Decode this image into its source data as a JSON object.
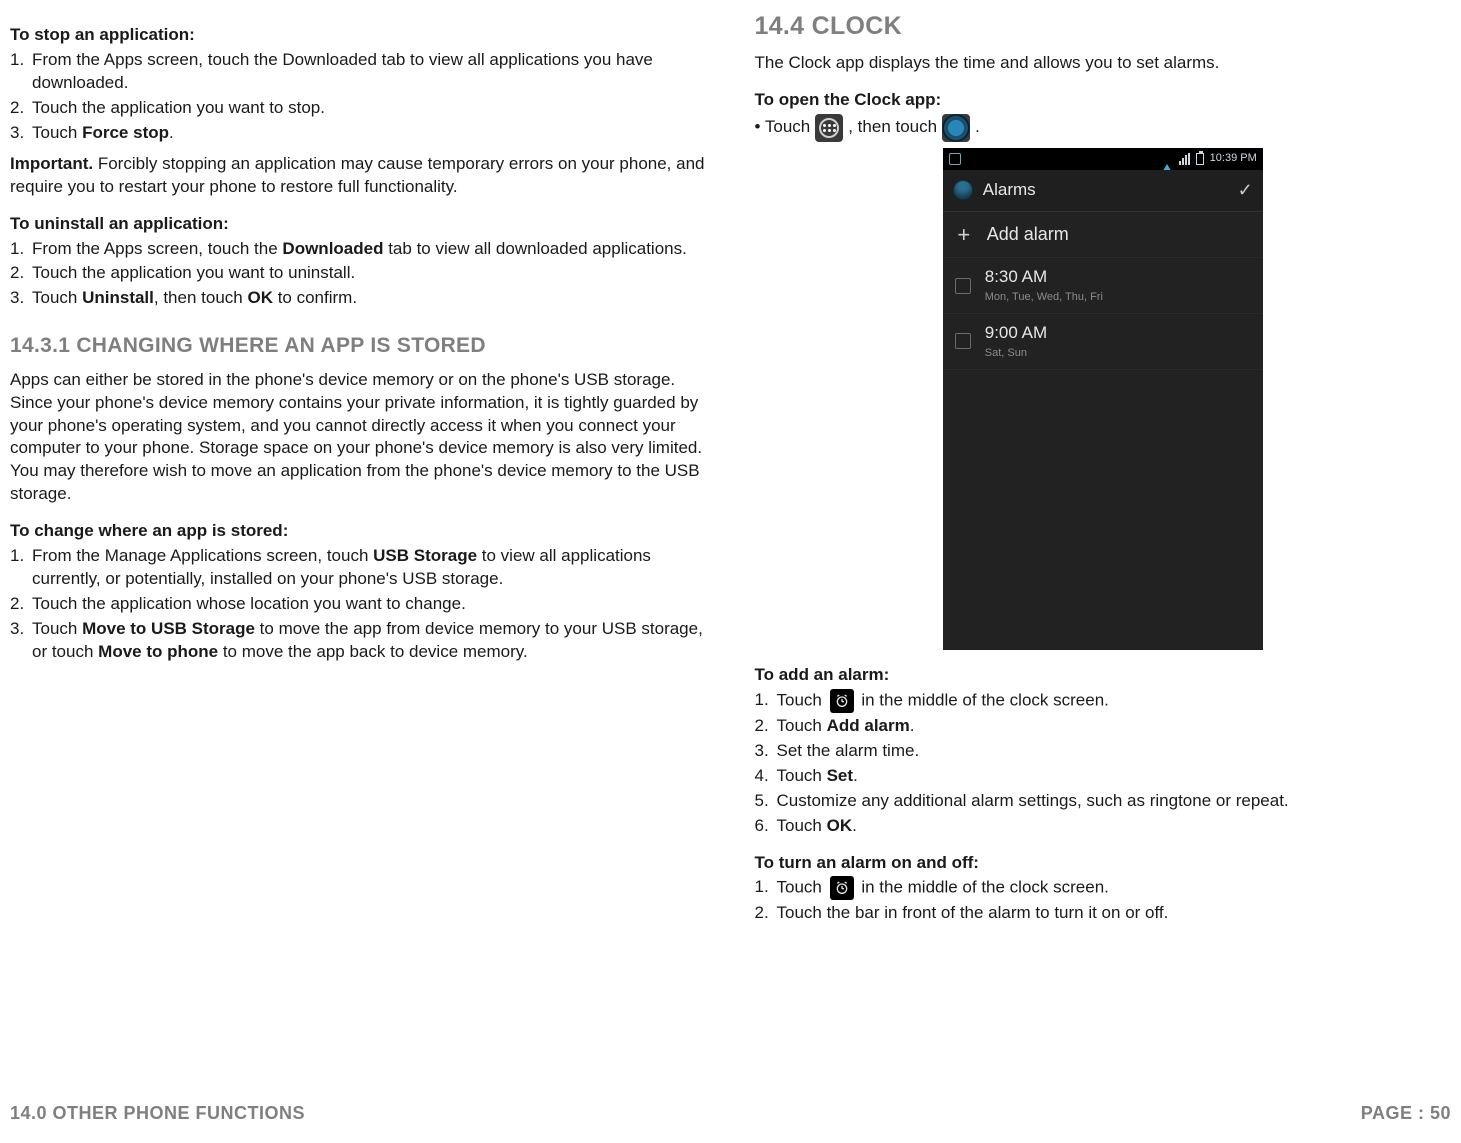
{
  "left": {
    "stop_app_heading": "To stop an application:",
    "stop_app_steps": [
      {
        "text": "From the Apps screen, touch the Downloaded tab to view all applications you have downloaded."
      },
      {
        "text": "Touch the application you want to stop."
      },
      {
        "prefix": "Touch ",
        "bold": "Force stop",
        "suffix": "."
      }
    ],
    "important_label": "Important.",
    "important_text": " Forcibly stopping an application may cause temporary errors on your phone, and require you to restart your phone to restore full functionality.",
    "uninstall_heading": "To uninstall an application:",
    "uninstall_steps": [
      {
        "prefix": "From the Apps screen, touch the ",
        "bold": "Downloaded",
        "suffix": " tab to view all downloaded applications."
      },
      {
        "text": "Touch the application you want to uninstall."
      },
      {
        "prefix": "Touch ",
        "bold": "Uninstall",
        "mid": ", then touch ",
        "bold2": "OK",
        "suffix": " to confirm."
      }
    ],
    "section_1431": "14.3.1 CHANGING WHERE AN APP IS STORED",
    "storage_para": "Apps can either be stored in the phone's device memory or on the phone's USB storage. Since your phone's device memory contains your private information, it is tightly guarded by your phone's operating system, and you cannot directly access it when you connect your computer to your phone. Storage space on your phone's device memory is also very limited. You may therefore wish to move an application from the phone's device memory to the USB storage.",
    "change_heading": "To change where an app is stored:",
    "change_steps": [
      {
        "prefix": "From the Manage Applications screen, touch ",
        "bold": "USB Storage",
        "suffix": " to view all applications currently, or potentially, installed on your phone's USB storage."
      },
      {
        "text": "Touch the application whose location you want to change."
      },
      {
        "prefix": "Touch ",
        "bold": "Move to USB Storage",
        "mid": " to move the app from device memory to your USB storage,",
        "line2_prefix": "or touch ",
        "line2_bold": "Move to phone",
        "line2_suffix": " to move the app back to device memory."
      }
    ]
  },
  "right": {
    "section_144": "14.4 CLOCK",
    "clock_intro": "The Clock app displays the time and allows you to set alarms.",
    "open_heading": "To open the Clock app:",
    "open_line_prefix": "• Touch ",
    "open_line_mid": ", then touch ",
    "open_line_suffix": ".",
    "add_heading": "To add an alarm:",
    "add_steps": [
      {
        "prefix": "Touch ",
        "icon": "alarm-icon",
        "suffix": " in the middle of the clock screen."
      },
      {
        "prefix": "Touch ",
        "bold": "Add alarm",
        "suffix": "."
      },
      {
        "text": "Set the alarm time."
      },
      {
        "prefix": "Touch ",
        "bold": "Set",
        "suffix": "."
      },
      {
        "text": "Customize any additional alarm settings, such as ringtone or repeat."
      },
      {
        "prefix": "Touch ",
        "bold": "OK",
        "suffix": "."
      }
    ],
    "toggle_heading": "To turn an alarm on and off:",
    "toggle_steps": [
      {
        "prefix": "Touch ",
        "icon": "alarm-icon",
        "suffix": " in the middle of the clock screen."
      },
      {
        "text": "Touch the bar in front of the alarm to turn it on or off."
      }
    ]
  },
  "phone": {
    "status_time": "10:39 PM",
    "appbar_title": "Alarms",
    "add_alarm": "Add alarm",
    "alarms": [
      {
        "time": "8:30 AM",
        "days": "Mon, Tue, Wed, Thu, Fri"
      },
      {
        "time": "9:00 AM",
        "days": "Sat, Sun"
      }
    ]
  },
  "footer": {
    "left": "14.0 OTHER PHONE FUNCTIONS",
    "right": "PAGE : 50"
  }
}
